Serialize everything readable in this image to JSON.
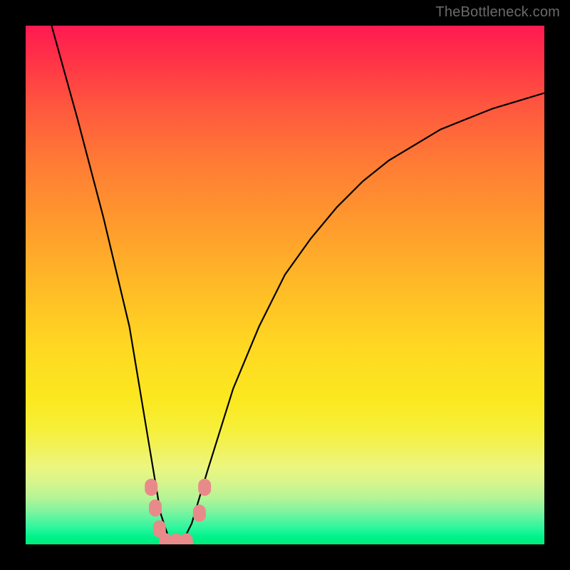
{
  "watermark": "TheBottleneck.com",
  "chart_data": {
    "type": "line",
    "title": "",
    "xlabel": "",
    "ylabel": "",
    "xlim": [
      0,
      100
    ],
    "ylim": [
      0,
      100
    ],
    "grid": false,
    "legend": false,
    "series": [
      {
        "name": "bottleneck-curve",
        "x": [
          5,
          10,
          15,
          20,
          24,
          26,
          28,
          30,
          32,
          35,
          40,
          45,
          50,
          55,
          60,
          65,
          70,
          75,
          80,
          85,
          90,
          95,
          100
        ],
        "y": [
          100,
          82,
          63,
          42,
          18,
          6,
          0,
          0,
          4,
          14,
          30,
          42,
          52,
          59,
          65,
          70,
          74,
          77,
          80,
          82,
          84,
          85.5,
          87
        ],
        "color": "#000000"
      }
    ],
    "markers": [
      {
        "name": "marker-left-1",
        "x": 24.2,
        "y": 11,
        "color": "#e98a8a"
      },
      {
        "name": "marker-left-2",
        "x": 25.0,
        "y": 7,
        "color": "#e98a8a"
      },
      {
        "name": "marker-left-3",
        "x": 25.8,
        "y": 3,
        "color": "#e98a8a"
      },
      {
        "name": "marker-bottom-1",
        "x": 27.0,
        "y": 0.5,
        "color": "#e98a8a"
      },
      {
        "name": "marker-bottom-2",
        "x": 29.0,
        "y": 0.5,
        "color": "#e98a8a"
      },
      {
        "name": "marker-bottom-3",
        "x": 31.0,
        "y": 0.5,
        "color": "#e98a8a"
      },
      {
        "name": "marker-right-1",
        "x": 33.5,
        "y": 6,
        "color": "#e98a8a"
      },
      {
        "name": "marker-right-2",
        "x": 34.5,
        "y": 11,
        "color": "#e98a8a"
      }
    ],
    "colors": {
      "gradient_top": "#ff1a52",
      "gradient_mid": "#ffd822",
      "gradient_bottom": "#00ec7a",
      "curve": "#000000",
      "marker": "#e98a8a",
      "frame": "#000000"
    }
  }
}
